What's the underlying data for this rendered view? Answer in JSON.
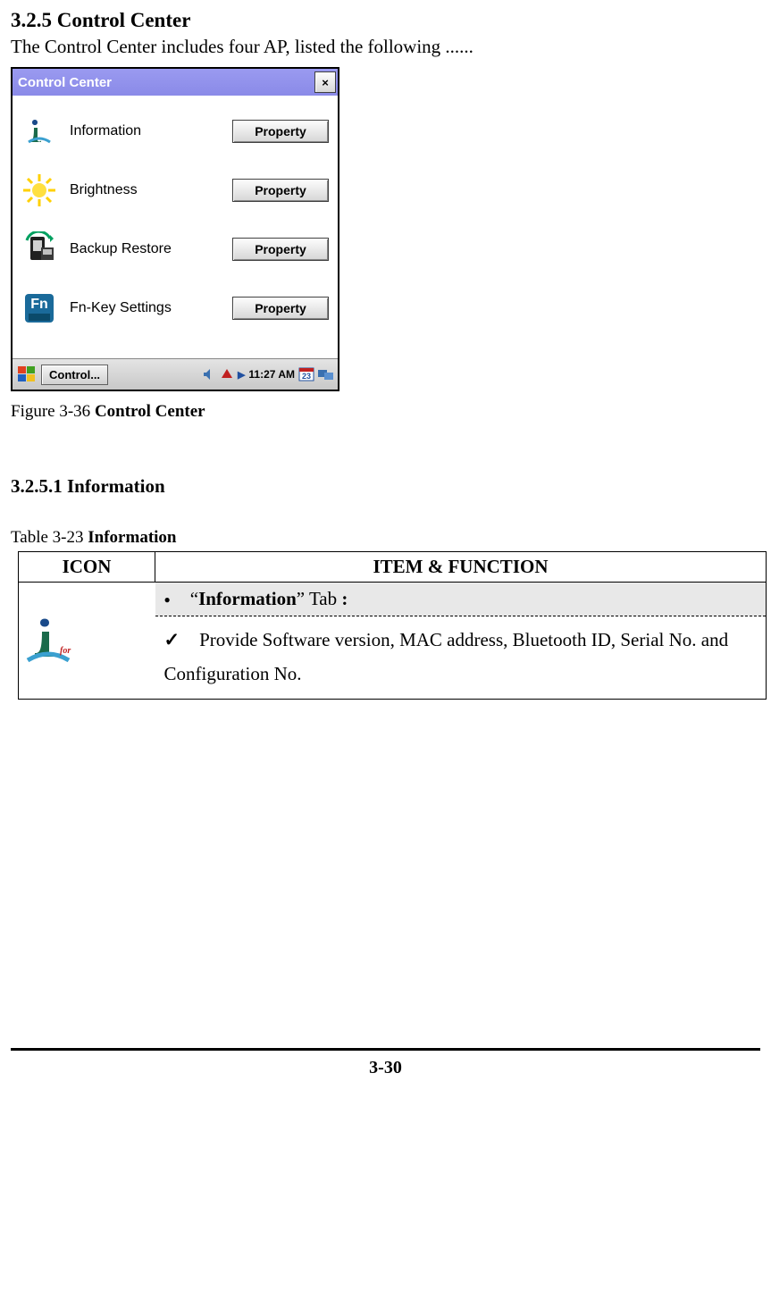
{
  "heading": "3.2.5 Control Center",
  "intro": "The Control Center includes four AP, listed the following ......",
  "control_center": {
    "title": "Control Center",
    "close": "×",
    "rows": [
      {
        "label": "Information",
        "button": "Property",
        "icon": "info"
      },
      {
        "label": "Brightness",
        "button": "Property",
        "icon": "brightness"
      },
      {
        "label": "Backup Restore",
        "button": "Property",
        "icon": "backup"
      },
      {
        "label": "Fn-Key Settings",
        "button": "Property",
        "icon": "fnkey"
      }
    ],
    "taskbar": {
      "task_label": "Control...",
      "clock": "11:27 AM"
    }
  },
  "figure_caption_prefix": "Figure 3-36 ",
  "figure_caption_bold": "Control Center",
  "subsection": "3.2.5.1 Information",
  "table_caption_prefix": "Table 3-23 ",
  "table_caption_bold": "Information",
  "table": {
    "head_icon": "ICON",
    "head_item": "ITEM & FUNCTION",
    "tab_prefix": "“",
    "tab_bold": "Information",
    "tab_suffix": "” Tab",
    "tab_colon": " :",
    "desc": "Provide Software version, MAC address, Bluetooth ID, Serial No. and Configuration No."
  },
  "page_number": "3-30"
}
